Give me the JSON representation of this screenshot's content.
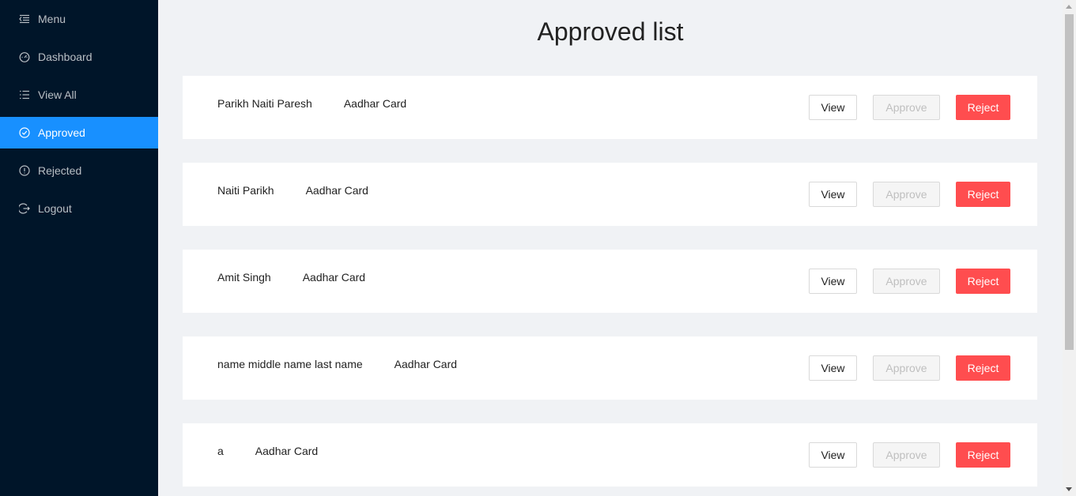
{
  "sidebar": {
    "items": [
      {
        "label": "Menu",
        "icon": "menu-fold-icon"
      },
      {
        "label": "Dashboard",
        "icon": "dashboard-icon"
      },
      {
        "label": "View All",
        "icon": "list-icon"
      },
      {
        "label": "Approved",
        "icon": "check-circle-icon"
      },
      {
        "label": "Rejected",
        "icon": "exclamation-circle-icon"
      },
      {
        "label": "Logout",
        "icon": "logout-icon"
      }
    ],
    "active": "Approved"
  },
  "main": {
    "title": "Approved list",
    "rows": [
      {
        "name": "Parikh Naiti Paresh",
        "document": "Aadhar Card"
      },
      {
        "name": "Naiti Parikh",
        "document": "Aadhar Card"
      },
      {
        "name": "Amit Singh",
        "document": "Aadhar Card"
      },
      {
        "name": "name middle name last name",
        "document": "Aadhar Card"
      },
      {
        "name": "a",
        "document": "Aadhar Card"
      }
    ],
    "buttons": {
      "view": "View",
      "approve": "Approve",
      "reject": "Reject"
    }
  },
  "colors": {
    "sidebar_bg": "#001529",
    "active": "#1890ff",
    "reject": "#ff4d4f",
    "page_bg": "#f0f2f5"
  }
}
